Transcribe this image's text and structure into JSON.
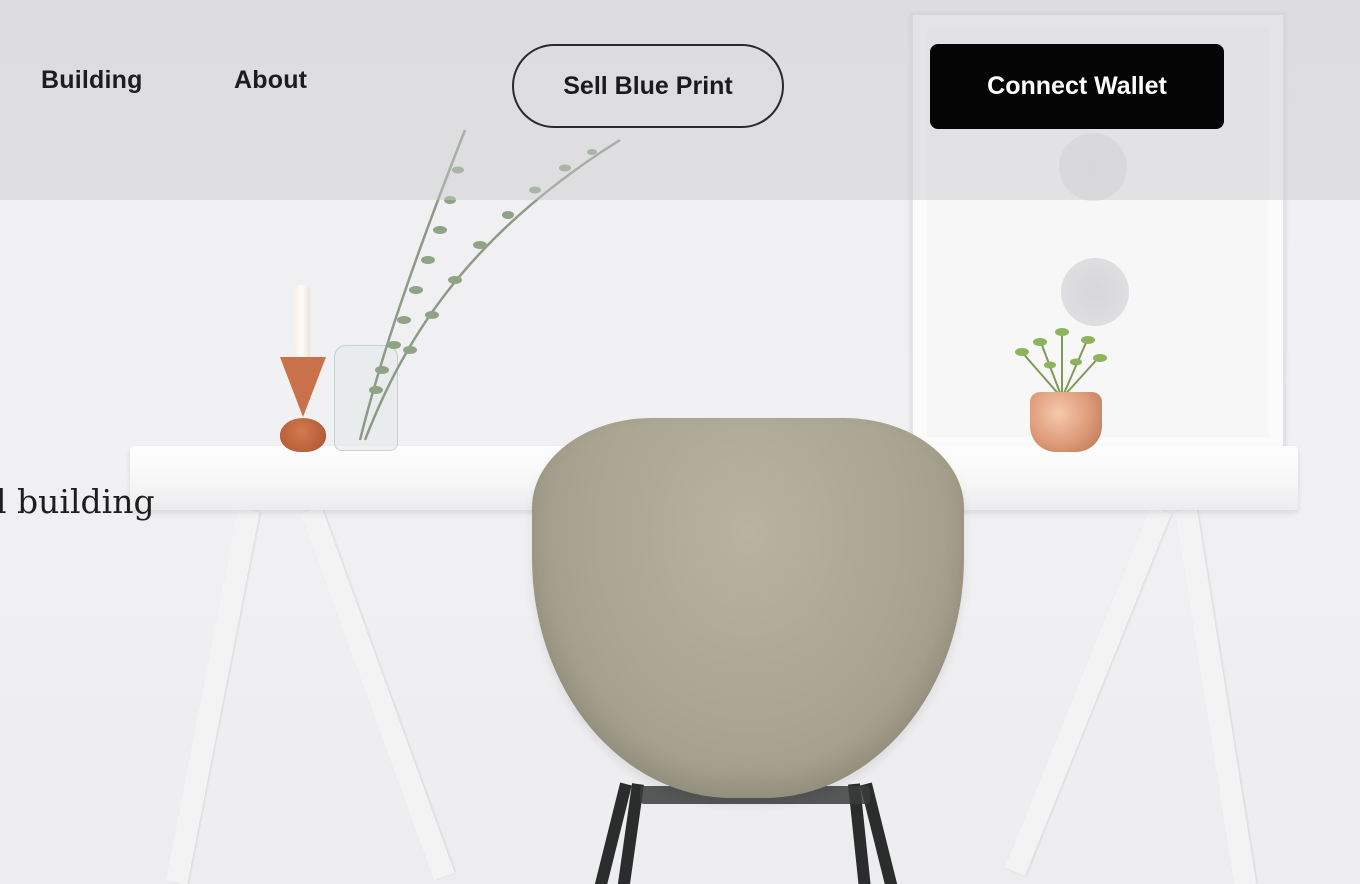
{
  "nav": {
    "links": [
      {
        "label": "Building"
      },
      {
        "label": "About"
      }
    ]
  },
  "header": {
    "sell_button_label": "Sell Blue Print",
    "wallet_button_label": "Connect Wallet"
  },
  "hero": {
    "visible_text": "l building"
  },
  "colors": {
    "wallet_button_bg": "#050505",
    "wallet_button_text": "#ffffff",
    "outline_button_border": "#2a2a2c",
    "chair": "#a9a490",
    "pot": "#dd9a78",
    "candle_holder": "#c9714a"
  }
}
